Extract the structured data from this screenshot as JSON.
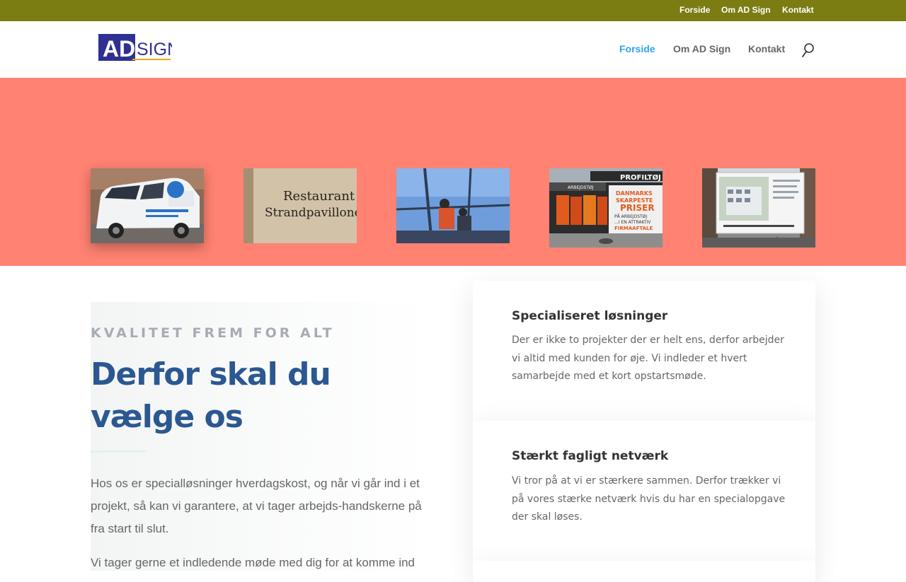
{
  "topbar": {
    "links": [
      "Forside",
      "Om AD Sign",
      "Kontakt"
    ]
  },
  "logo": {
    "text_ad": "AD",
    "text_sign": "SIGN"
  },
  "nav": {
    "items": [
      "Forside",
      "Om AD Sign",
      "Kontakt"
    ],
    "active": "Forside"
  },
  "icons": {
    "search": "search-icon"
  },
  "gallery": {
    "restaurant_sign_line1": "Restaurant",
    "restaurant_sign_line2": "Strandpavillonen",
    "banner_header": "PROFILTØJ",
    "banner_left": "ARBEJDSTØJ",
    "banner_text": [
      "DANMARKS",
      "SKARPESTE",
      "PRISER",
      "PÅ ARBEJDSTØJ",
      "...I EN ATTRAKTIV",
      "FIRMAAFTALE"
    ]
  },
  "intro": {
    "eyebrow": "KVALITET FREM FOR ALT",
    "headline": "Derfor skal du vælge os",
    "paragraph1": "Hos os er specialløsninger hverdagskost, og når vi går ind i et projekt, så kan vi garantere, at vi tager arbejds-handskerne på fra start til slut.",
    "paragraph2": "Vi tager gerne et indledende møde med dig for at komme ind"
  },
  "features": [
    {
      "title": "Specialiseret løsninger",
      "text": "Der er ikke to projekter der er helt ens, derfor arbejder vi altid med kunden for øje. Vi indleder et hvert samarbejde med et kort opstartsmøde."
    },
    {
      "title": "Stærkt fagligt netværk",
      "text": "Vi tror på at vi er stærkere sammen. Derfor trækker vi på vores stærke netværk hvis du har en specialopgave der skal løses."
    }
  ],
  "colors": {
    "topbar": "#7b7c12",
    "hero": "#ff8272",
    "accent": "#2ea3f2",
    "headline": "#2b5891"
  }
}
